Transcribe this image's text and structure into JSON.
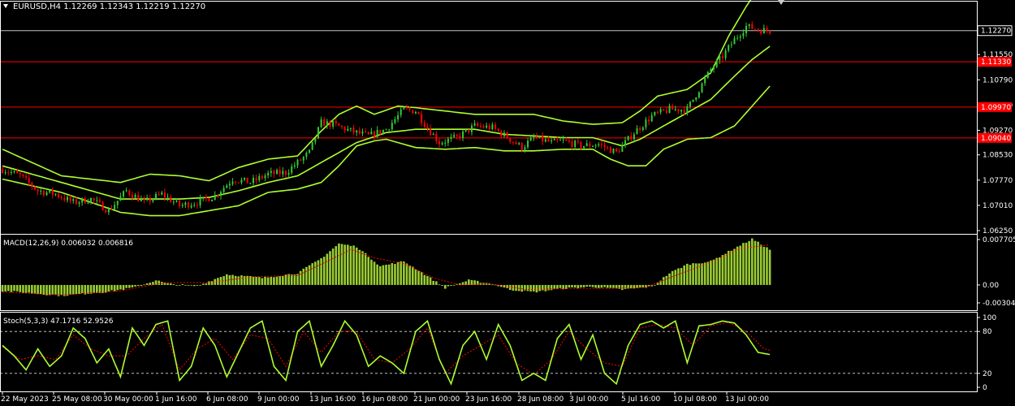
{
  "header": {
    "symbol_line": "EURUSD,H4  1.12269 1.12343 1.12219 1.12270",
    "macd_label": "MACD(12,26,9) 0.006032 0.006816",
    "stoch_label": "Stoch(5,3,3) 47.1716 52.9526"
  },
  "colors": {
    "background": "#000000",
    "bull": "#32cd32",
    "bear": "#ff0000",
    "bands": "#adff2f",
    "macd_hist": "#9acd32",
    "macd_signal": "#ff0000",
    "stoch_main": "#adff2f",
    "stoch_signal": "#ff0000",
    "hline": "#ff0000",
    "axis_text": "#ffffff"
  },
  "chart_data": [
    {
      "type": "candlestick",
      "title": "EURUSD,H4",
      "ohlc_current": {
        "open": 1.12269,
        "high": 1.12343,
        "low": 1.12219,
        "close": 1.1227
      },
      "y_ticks": [
        "1.12270",
        "1.11550",
        "1.10790",
        "1.10030",
        "1.09270",
        "1.08530",
        "1.07770",
        "1.07010",
        "1.06250"
      ],
      "ylim": [
        1.0625,
        1.1285
      ],
      "current_price": "1.12270",
      "horizontal_lines": [
        {
          "price": 1.1133,
          "label": "1.11330"
        },
        {
          "price": 1.0997,
          "label": "1.09970"
        },
        {
          "price": 1.0904,
          "label": "1.09040"
        }
      ],
      "x_ticks": [
        "22 May 2023",
        "25 May 08:00",
        "30 May 00:00",
        "1 Jun 16:00",
        "6 Jun 08:00",
        "9 Jun 00:00",
        "13 Jun 16:00",
        "16 Jun 08:00",
        "21 Jun 00:00",
        "23 Jun 16:00",
        "28 Jun 08:00",
        "3 Jul 00:00",
        "5 Jul 16:00",
        "10 Jul 08:00",
        "13 Jul 00:00"
      ],
      "anchors": [
        [
          0,
          1.081
        ],
        [
          6,
          1.079
        ],
        [
          12,
          1.0745
        ],
        [
          18,
          1.0735
        ],
        [
          24,
          1.071
        ],
        [
          30,
          1.072
        ],
        [
          36,
          1.0685
        ],
        [
          42,
          1.0745
        ],
        [
          48,
          1.071
        ],
        [
          54,
          1.0735
        ],
        [
          60,
          1.07
        ],
        [
          66,
          1.071
        ],
        [
          72,
          1.073
        ],
        [
          78,
          1.078
        ],
        [
          84,
          1.077
        ],
        [
          90,
          1.0795
        ],
        [
          96,
          1.08
        ],
        [
          100,
          1.083
        ],
        [
          104,
          1.086
        ],
        [
          108,
          1.095
        ],
        [
          112,
          1.0945
        ],
        [
          118,
          1.0925
        ],
        [
          124,
          1.091
        ],
        [
          130,
          1.093
        ],
        [
          136,
          1.099
        ],
        [
          140,
          1.0985
        ],
        [
          144,
          1.0935
        ],
        [
          148,
          1.089
        ],
        [
          154,
          1.0905
        ],
        [
          160,
          1.094
        ],
        [
          166,
          1.0935
        ],
        [
          172,
          1.09
        ],
        [
          176,
          1.0875
        ],
        [
          180,
          1.0905
        ],
        [
          186,
          1.089
        ],
        [
          190,
          1.0895
        ],
        [
          196,
          1.088
        ],
        [
          202,
          1.0885
        ],
        [
          208,
          1.086
        ],
        [
          214,
          1.092
        ],
        [
          220,
          1.097
        ],
        [
          226,
          1.099
        ],
        [
          232,
          1.099
        ],
        [
          236,
          1.105
        ],
        [
          240,
          1.111
        ],
        [
          244,
          1.115
        ],
        [
          248,
          1.12
        ],
        [
          252,
          1.124
        ],
        [
          256,
          1.123
        ],
        [
          260,
          1.1227
        ]
      ],
      "bands_upper": [
        [
          0,
          1.087
        ],
        [
          20,
          1.079
        ],
        [
          40,
          1.077
        ],
        [
          50,
          1.0795
        ],
        [
          60,
          1.079
        ],
        [
          70,
          1.0775
        ],
        [
          80,
          1.0815
        ],
        [
          90,
          1.084
        ],
        [
          100,
          1.085
        ],
        [
          108,
          1.0925
        ],
        [
          114,
          1.0975
        ],
        [
          120,
          1.1
        ],
        [
          126,
          1.0975
        ],
        [
          134,
          1.1
        ],
        [
          140,
          1.0995
        ],
        [
          150,
          1.0985
        ],
        [
          160,
          1.0975
        ],
        [
          170,
          1.0975
        ],
        [
          180,
          1.0975
        ],
        [
          190,
          1.0955
        ],
        [
          200,
          1.0945
        ],
        [
          210,
          1.095
        ],
        [
          216,
          1.0985
        ],
        [
          222,
          1.103
        ],
        [
          232,
          1.105
        ],
        [
          240,
          1.11
        ],
        [
          246,
          1.121
        ],
        [
          252,
          1.13
        ],
        [
          258,
          1.138
        ]
      ],
      "bands_middle": [
        [
          0,
          1.082
        ],
        [
          20,
          1.077
        ],
        [
          40,
          1.072
        ],
        [
          60,
          1.072
        ],
        [
          70,
          1.0725
        ],
        [
          80,
          1.0745
        ],
        [
          90,
          1.077
        ],
        [
          100,
          1.079
        ],
        [
          110,
          1.084
        ],
        [
          120,
          1.089
        ],
        [
          130,
          1.092
        ],
        [
          140,
          1.093
        ],
        [
          150,
          1.093
        ],
        [
          160,
          1.093
        ],
        [
          170,
          1.0915
        ],
        [
          180,
          1.091
        ],
        [
          190,
          1.0905
        ],
        [
          200,
          1.0905
        ],
        [
          210,
          1.088
        ],
        [
          216,
          1.09
        ],
        [
          222,
          1.093
        ],
        [
          232,
          1.098
        ],
        [
          240,
          1.102
        ],
        [
          248,
          1.109
        ],
        [
          254,
          1.114
        ],
        [
          260,
          1.118
        ]
      ],
      "bands_lower": [
        [
          0,
          1.078
        ],
        [
          20,
          1.074
        ],
        [
          40,
          1.068
        ],
        [
          50,
          1.067
        ],
        [
          60,
          1.067
        ],
        [
          70,
          1.0685
        ],
        [
          80,
          1.07
        ],
        [
          90,
          1.074
        ],
        [
          100,
          1.075
        ],
        [
          108,
          1.077
        ],
        [
          114,
          1.082
        ],
        [
          120,
          1.088
        ],
        [
          126,
          1.0895
        ],
        [
          130,
          1.09
        ],
        [
          140,
          1.0875
        ],
        [
          150,
          1.087
        ],
        [
          160,
          1.0875
        ],
        [
          170,
          1.0865
        ],
        [
          180,
          1.0865
        ],
        [
          190,
          1.087
        ],
        [
          200,
          1.087
        ],
        [
          206,
          1.084
        ],
        [
          212,
          1.082
        ],
        [
          218,
          1.082
        ],
        [
          224,
          1.087
        ],
        [
          232,
          1.09
        ],
        [
          240,
          1.0905
        ],
        [
          248,
          1.094
        ],
        [
          254,
          1.1
        ],
        [
          260,
          1.106
        ]
      ]
    },
    {
      "type": "bar",
      "title": "MACD(12,26,9)",
      "macd": 0.006032,
      "signal": 0.006816,
      "y_ticks": [
        "0.007705",
        "0.00",
        "-0.00304"
      ],
      "ylim": [
        -0.00304,
        0.007705
      ],
      "anchors": [
        [
          0,
          -0.001
        ],
        [
          20,
          -0.0018
        ],
        [
          35,
          -0.0012
        ],
        [
          45,
          -0.0004
        ],
        [
          52,
          0.0008
        ],
        [
          56,
          0.0002
        ],
        [
          66,
          -0.0002
        ],
        [
          76,
          0.0018
        ],
        [
          88,
          0.0012
        ],
        [
          100,
          0.002
        ],
        [
          108,
          0.0045
        ],
        [
          114,
          0.007
        ],
        [
          120,
          0.0065
        ],
        [
          128,
          0.0032
        ],
        [
          136,
          0.004
        ],
        [
          144,
          0.0015
        ],
        [
          150,
          -0.0005
        ],
        [
          158,
          0.0008
        ],
        [
          166,
          0.0002
        ],
        [
          172,
          -0.0008
        ],
        [
          180,
          -0.0012
        ],
        [
          190,
          -0.0006
        ],
        [
          200,
          -0.0003
        ],
        [
          210,
          -0.0008
        ],
        [
          220,
          -0.0003
        ],
        [
          226,
          0.002
        ],
        [
          232,
          0.0035
        ],
        [
          240,
          0.004
        ],
        [
          248,
          0.0062
        ],
        [
          254,
          0.0078
        ],
        [
          260,
          0.006
        ]
      ],
      "signal_anchors": [
        [
          0,
          -0.0012
        ],
        [
          20,
          -0.0017
        ],
        [
          40,
          -0.001
        ],
        [
          55,
          0.0004
        ],
        [
          70,
          0.0004
        ],
        [
          85,
          0.0014
        ],
        [
          100,
          0.0016
        ],
        [
          110,
          0.004
        ],
        [
          118,
          0.006
        ],
        [
          126,
          0.0046
        ],
        [
          136,
          0.0036
        ],
        [
          146,
          0.0012
        ],
        [
          155,
          0.0
        ],
        [
          165,
          0.0002
        ],
        [
          178,
          -0.0008
        ],
        [
          192,
          -0.0006
        ],
        [
          206,
          -0.0006
        ],
        [
          218,
          -0.0004
        ],
        [
          228,
          0.0016
        ],
        [
          240,
          0.0038
        ],
        [
          250,
          0.0062
        ],
        [
          260,
          0.0068
        ]
      ]
    },
    {
      "type": "line",
      "title": "Stoch(5,3,3)",
      "main": 47.1716,
      "signal": 52.9526,
      "y_ticks": [
        "100",
        "80",
        "20",
        "0"
      ],
      "ylim": [
        0,
        100
      ],
      "levels": [
        80,
        20
      ],
      "anchors": [
        [
          0,
          60
        ],
        [
          4,
          45
        ],
        [
          8,
          25
        ],
        [
          12,
          55
        ],
        [
          16,
          30
        ],
        [
          20,
          45
        ],
        [
          24,
          85
        ],
        [
          28,
          70
        ],
        [
          32,
          35
        ],
        [
          36,
          55
        ],
        [
          40,
          15
        ],
        [
          44,
          85
        ],
        [
          48,
          60
        ],
        [
          52,
          90
        ],
        [
          56,
          95
        ],
        [
          60,
          10
        ],
        [
          64,
          30
        ],
        [
          68,
          85
        ],
        [
          72,
          60
        ],
        [
          76,
          15
        ],
        [
          80,
          50
        ],
        [
          84,
          85
        ],
        [
          88,
          95
        ],
        [
          92,
          30
        ],
        [
          96,
          10
        ],
        [
          100,
          80
        ],
        [
          104,
          95
        ],
        [
          108,
          30
        ],
        [
          112,
          60
        ],
        [
          116,
          95
        ],
        [
          120,
          75
        ],
        [
          124,
          30
        ],
        [
          128,
          45
        ],
        [
          132,
          35
        ],
        [
          136,
          20
        ],
        [
          140,
          80
        ],
        [
          144,
          95
        ],
        [
          148,
          40
        ],
        [
          152,
          5
        ],
        [
          156,
          60
        ],
        [
          160,
          80
        ],
        [
          164,
          40
        ],
        [
          168,
          90
        ],
        [
          172,
          60
        ],
        [
          176,
          10
        ],
        [
          180,
          20
        ],
        [
          184,
          10
        ],
        [
          188,
          70
        ],
        [
          192,
          90
        ],
        [
          196,
          40
        ],
        [
          200,
          75
        ],
        [
          204,
          20
        ],
        [
          208,
          5
        ],
        [
          212,
          60
        ],
        [
          216,
          90
        ],
        [
          220,
          95
        ],
        [
          224,
          85
        ],
        [
          228,
          95
        ],
        [
          232,
          35
        ],
        [
          236,
          88
        ],
        [
          240,
          90
        ],
        [
          244,
          95
        ],
        [
          248,
          92
        ],
        [
          252,
          75
        ],
        [
          256,
          50
        ],
        [
          260,
          47
        ]
      ],
      "signal_anchors": [
        [
          0,
          58
        ],
        [
          6,
          40
        ],
        [
          12,
          45
        ],
        [
          18,
          40
        ],
        [
          24,
          75
        ],
        [
          30,
          55
        ],
        [
          36,
          45
        ],
        [
          42,
          45
        ],
        [
          48,
          70
        ],
        [
          54,
          90
        ],
        [
          60,
          25
        ],
        [
          66,
          55
        ],
        [
          72,
          70
        ],
        [
          78,
          40
        ],
        [
          84,
          75
        ],
        [
          90,
          70
        ],
        [
          96,
          30
        ],
        [
          102,
          80
        ],
        [
          108,
          50
        ],
        [
          114,
          80
        ],
        [
          120,
          80
        ],
        [
          126,
          40
        ],
        [
          132,
          35
        ],
        [
          138,
          55
        ],
        [
          144,
          85
        ],
        [
          150,
          20
        ],
        [
          156,
          45
        ],
        [
          162,
          60
        ],
        [
          168,
          75
        ],
        [
          174,
          35
        ],
        [
          180,
          18
        ],
        [
          186,
          40
        ],
        [
          192,
          80
        ],
        [
          198,
          55
        ],
        [
          204,
          35
        ],
        [
          210,
          30
        ],
        [
          216,
          85
        ],
        [
          222,
          90
        ],
        [
          228,
          85
        ],
        [
          234,
          60
        ],
        [
          240,
          88
        ],
        [
          246,
          93
        ],
        [
          252,
          80
        ],
        [
          258,
          55
        ],
        [
          260,
          53
        ]
      ]
    }
  ]
}
